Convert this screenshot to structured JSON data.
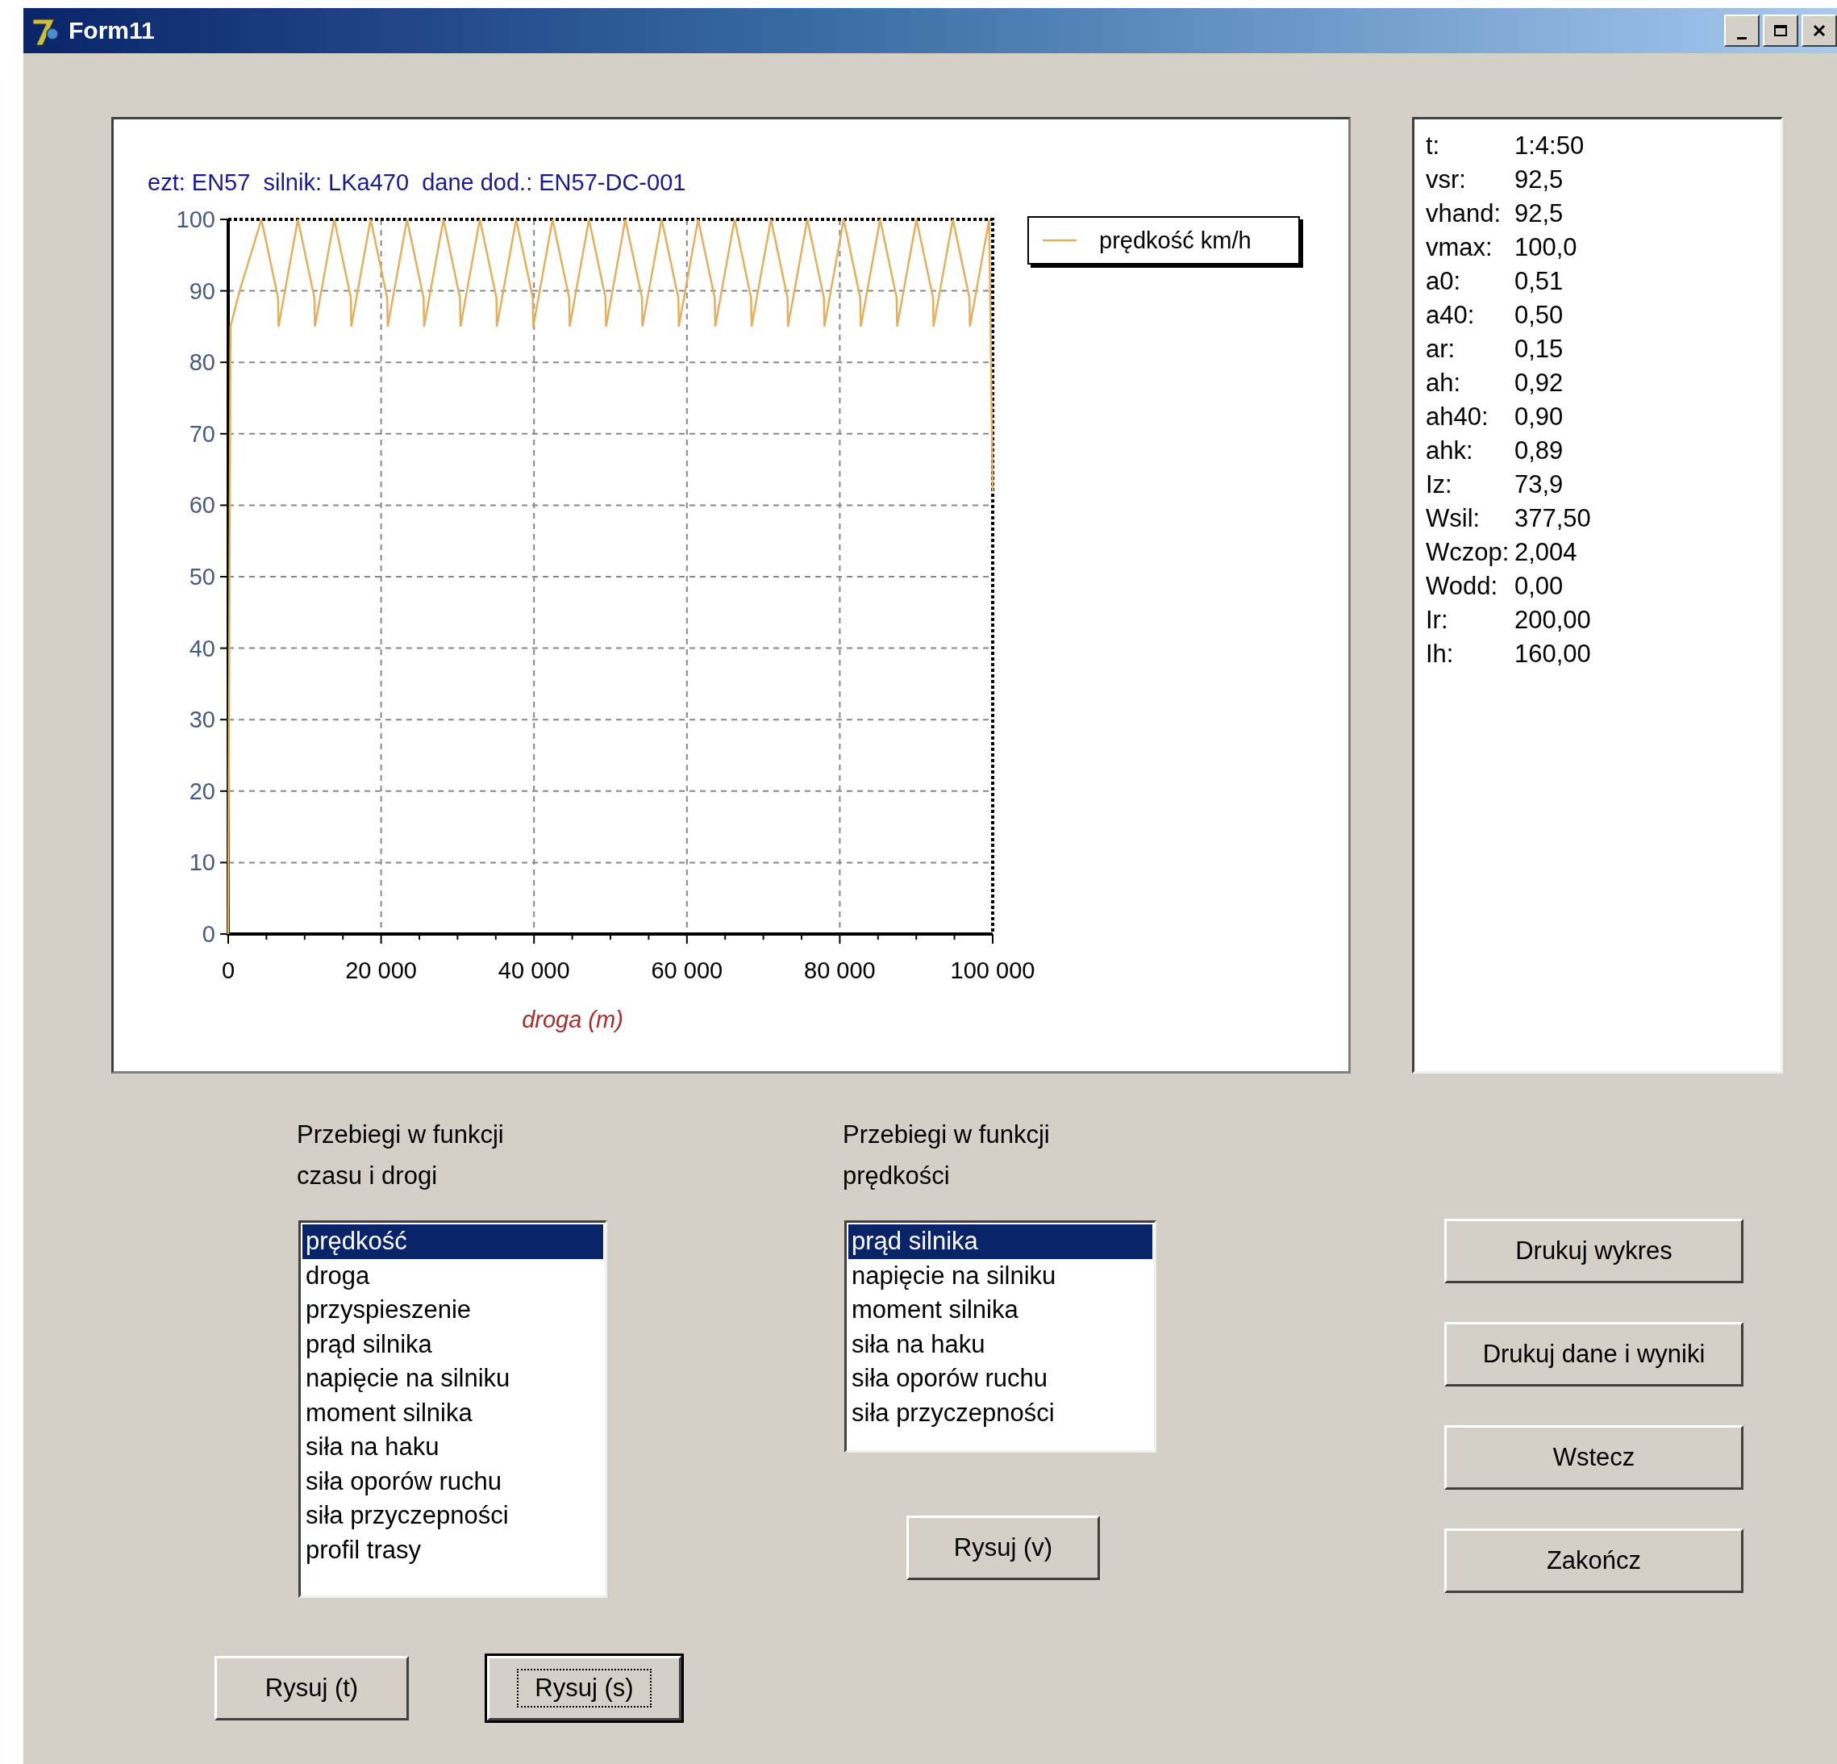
{
  "window": {
    "title": "Form11",
    "controls": [
      {
        "kind": "minimize"
      },
      {
        "kind": "maximize"
      },
      {
        "kind": "close"
      }
    ]
  },
  "chart": {
    "chart_data": {
      "type": "line",
      "title": "ezt: EN57  silnik: LKa470  dane dod.: EN57-DC-001",
      "xlabel": "droga (m)",
      "x": [
        0,
        300,
        1500,
        4350,
        6520,
        6580,
        9110,
        11280,
        11340,
        13870,
        16040,
        16100,
        18630,
        20800,
        20860,
        23390,
        25560,
        25620,
        28150,
        30320,
        30380,
        32910,
        35080,
        35140,
        37670,
        39840,
        39900,
        42430,
        44600,
        44660,
        47190,
        49360,
        49420,
        51950,
        54120,
        54180,
        56710,
        58880,
        58940,
        61470,
        63640,
        63700,
        66230,
        68400,
        68460,
        70990,
        73160,
        73220,
        75750,
        77920,
        77980,
        80510,
        82680,
        82740,
        85270,
        87440,
        87500,
        90030,
        92200,
        92260,
        94790,
        96960,
        97020,
        99550,
        100000
      ],
      "series": [
        {
          "name": "prędkość km/h",
          "color": "#e0b060",
          "values": [
            0,
            85,
            90,
            100,
            89,
            85,
            100,
            89,
            85,
            100,
            89,
            85,
            100,
            89,
            85,
            100,
            89,
            85,
            100,
            89,
            85,
            100,
            89,
            85,
            100,
            89,
            85,
            100,
            89,
            85,
            100,
            89,
            85,
            100,
            89,
            85,
            100,
            89,
            85,
            100,
            89,
            85,
            100,
            89,
            85,
            100,
            89,
            85,
            100,
            89,
            85,
            100,
            89,
            85,
            100,
            89,
            85,
            100,
            89,
            85,
            100,
            89,
            85,
            100,
            62
          ]
        }
      ],
      "grid": true,
      "xlim": [
        0,
        100000
      ],
      "ylim": [
        0,
        100
      ],
      "xticks": [
        0,
        {
          "value": 20000,
          "label": "20 000"
        },
        {
          "value": 40000,
          "label": "40 000"
        },
        {
          "value": 60000,
          "label": "60 000"
        },
        {
          "value": 80000,
          "label": "80 000"
        },
        {
          "value": 100000,
          "label": "100 000"
        }
      ],
      "yticks": [
        0,
        10,
        20,
        30,
        40,
        50,
        60,
        70,
        80,
        90,
        100
      ]
    }
  },
  "info_panel": {
    "rows": [
      {
        "label": "t:",
        "value": "1:4:50"
      },
      {
        "label": "vsr:",
        "value": "92,5"
      },
      {
        "label": "vhand:",
        "value": "92,5"
      },
      {
        "label": "vmax:",
        "value": "100,0"
      },
      {
        "label": "a0:",
        "value": "0,51"
      },
      {
        "label": "a40:",
        "value": "0,50"
      },
      {
        "label": "ar:",
        "value": "0,15"
      },
      {
        "label": "ah:",
        "value": "0,92"
      },
      {
        "label": "ah40:",
        "value": "0,90"
      },
      {
        "label": "ahk:",
        "value": "0,89"
      },
      {
        "label": "Iz:",
        "value": "73,9"
      },
      {
        "label": "Wsil:",
        "value": "377,50"
      },
      {
        "label": "Wczop:",
        "value": "2,004"
      },
      {
        "label": "Wodd:",
        "value": "0,00"
      },
      {
        "label": "Ir:",
        "value": "200,00"
      },
      {
        "label": "Ih:",
        "value": "160,00"
      }
    ]
  },
  "time_distance": {
    "heading": "Przebiegi w funkcji czasu i drogi",
    "items": [
      {
        "label": "prędkość",
        "selected": true
      },
      {
        "label": "droga",
        "selected": false
      },
      {
        "label": "przyspieszenie",
        "selected": false
      },
      {
        "label": "prąd silnika",
        "selected": false
      },
      {
        "label": "napięcie na silniku",
        "selected": false
      },
      {
        "label": "moment silnika",
        "selected": false
      },
      {
        "label": "siła na haku",
        "selected": false
      },
      {
        "label": "siła oporów ruchu",
        "selected": false
      },
      {
        "label": "siła przyczepności",
        "selected": false
      },
      {
        "label": "profil trasy",
        "selected": false
      }
    ],
    "buttons": [
      {
        "label": "Rysuj (t)",
        "focused": false
      },
      {
        "label": "Rysuj (s)",
        "focused": true
      }
    ]
  },
  "speed": {
    "heading": "Przebiegi w funkcji prędkości",
    "items": [
      {
        "label": "prąd silnika",
        "selected": true
      },
      {
        "label": "napięcie na silniku",
        "selected": false
      },
      {
        "label": "moment silnika",
        "selected": false
      },
      {
        "label": "siła na haku",
        "selected": false
      },
      {
        "label": "siła oporów ruchu",
        "selected": false
      },
      {
        "label": "siła przyczepności",
        "selected": false
      }
    ],
    "button": {
      "label": "Rysuj (v)",
      "focused": false
    }
  },
  "actions": [
    {
      "label": "Drukuj wykres"
    },
    {
      "label": "Drukuj dane i wyniki"
    },
    {
      "label": "Wstecz"
    },
    {
      "label": "Zakończ"
    }
  ]
}
